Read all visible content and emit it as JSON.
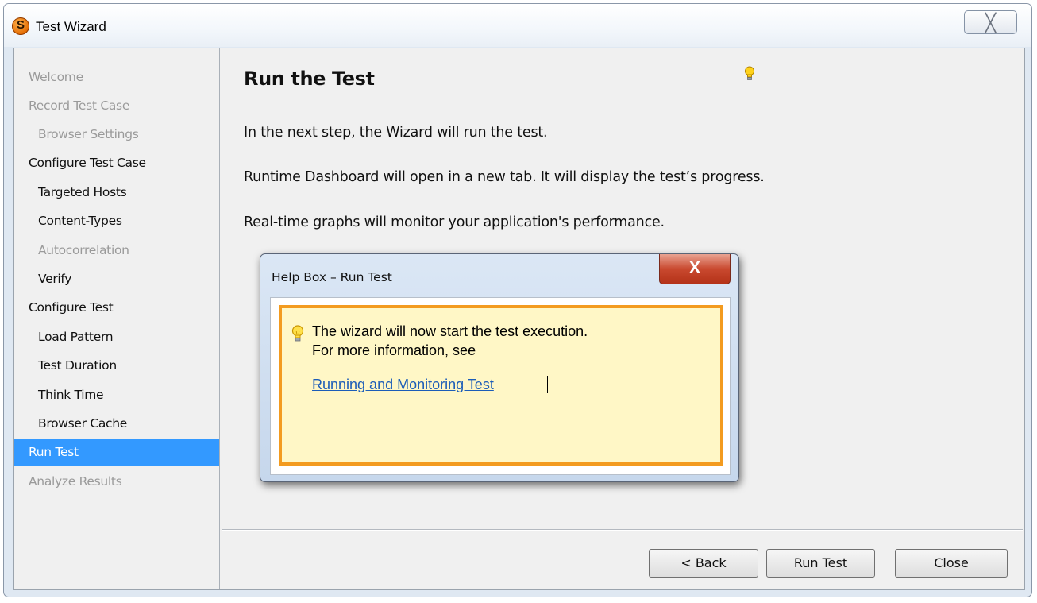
{
  "window": {
    "title": "Test Wizard",
    "app_icon": "app-logo-icon",
    "app_icon_letter": "S",
    "close_icon": "╳"
  },
  "sidebar": {
    "items": [
      {
        "label": "Welcome",
        "state": "disabled",
        "indent": 0
      },
      {
        "label": "Record Test Case",
        "state": "disabled",
        "indent": 0
      },
      {
        "label": "Browser Settings",
        "state": "disabled",
        "indent": 1
      },
      {
        "label": "Configure Test Case",
        "state": "normal",
        "indent": 0
      },
      {
        "label": "Targeted Hosts",
        "state": "normal",
        "indent": 1
      },
      {
        "label": "Content-Types",
        "state": "normal",
        "indent": 1
      },
      {
        "label": "Autocorrelation",
        "state": "disabled",
        "indent": 1
      },
      {
        "label": "Verify",
        "state": "normal",
        "indent": 1
      },
      {
        "label": "Configure Test",
        "state": "normal",
        "indent": 0
      },
      {
        "label": "Load Pattern",
        "state": "normal",
        "indent": 1
      },
      {
        "label": "Test Duration",
        "state": "normal",
        "indent": 1
      },
      {
        "label": "Think Time",
        "state": "normal",
        "indent": 1
      },
      {
        "label": "Browser Cache",
        "state": "normal",
        "indent": 1
      },
      {
        "label": "Run Test",
        "state": "active",
        "indent": 0
      },
      {
        "label": "Analyze Results",
        "state": "disabled",
        "indent": 0
      }
    ]
  },
  "main": {
    "heading": "Run the Test",
    "hint_icon": "lightbulb-icon",
    "paragraphs": [
      "In the next step, the Wizard will run the test.",
      "Runtime Dashboard will open in a new tab. It will display the test’s progress.",
      "Real-time graphs will monitor your application's performance."
    ]
  },
  "help_box": {
    "title": "Help Box – Run Test",
    "close_icon": "X",
    "line1": "The wizard will now start the test execution.",
    "line2": "For more information, see",
    "link": "Running and Monitoring Test"
  },
  "footer": {
    "back_label": "< Back",
    "run_label": "Run Test",
    "close_label": "Close"
  },
  "colors": {
    "active_step": "#3399ff",
    "help_highlight_border": "#f39b1f",
    "help_highlight_bg": "#fff7c6",
    "link": "#1c5db8"
  }
}
